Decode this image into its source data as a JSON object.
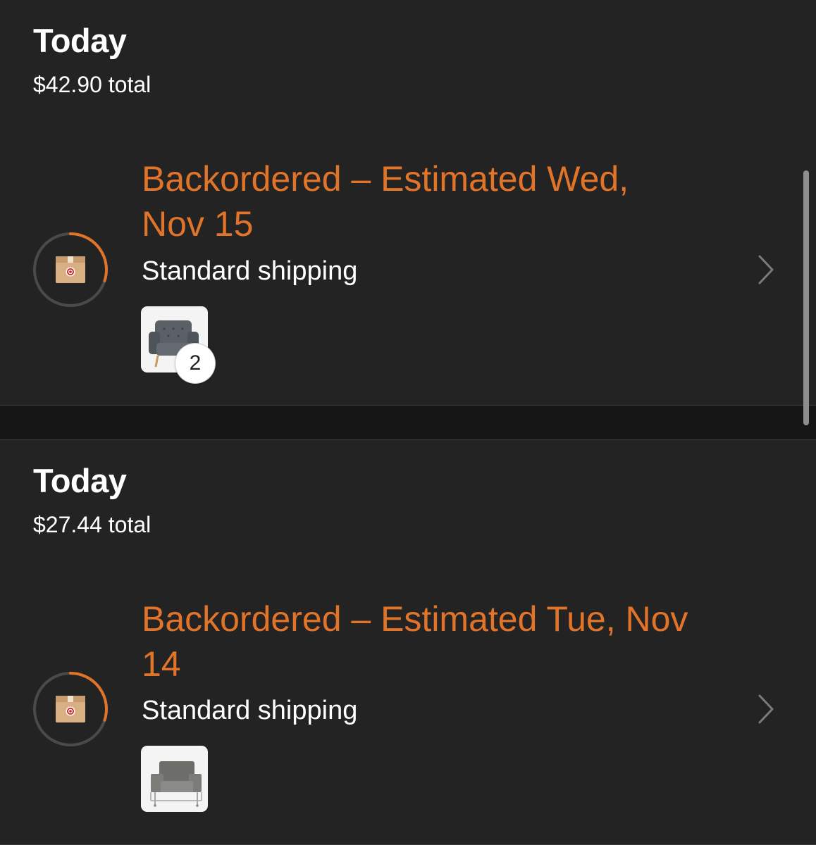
{
  "orders": [
    {
      "date": "Today",
      "total": "$42.90 total",
      "status": "Backordered – Estimated Wed, Nov 15",
      "shipping": "Standard shipping",
      "progress": 0.3,
      "items": [
        {
          "image": "gray-tufted-armchair",
          "quantity": "2"
        }
      ]
    },
    {
      "date": "Today",
      "total": "$27.44 total",
      "status": "Backordered – Estimated Tue, Nov 14",
      "shipping": "Standard shipping",
      "progress": 0.3,
      "items": [
        {
          "image": "gray-metal-frame-armchair"
        }
      ]
    }
  ],
  "icons": {
    "status": "package-icon",
    "chevron": "chevron-right-icon"
  },
  "colors": {
    "accent": "#e2742a",
    "background": "#232323",
    "separator": "#161616",
    "text": "#ffffff"
  }
}
